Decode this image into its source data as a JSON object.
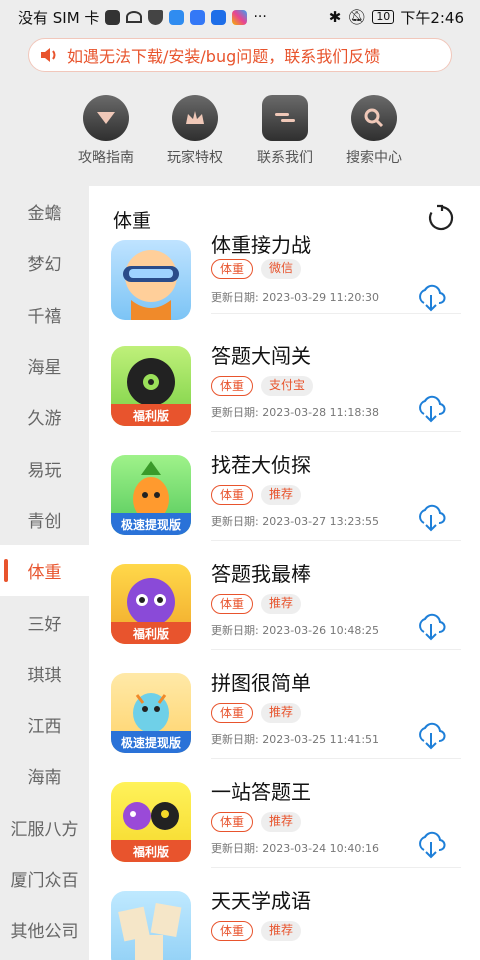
{
  "status_bar": {
    "carrier": "没有 SIM 卡",
    "battery": "10",
    "time": "下午2:46"
  },
  "notice": {
    "text": "如遇无法下载/安装/bug问题，联系我们反馈",
    "icon": "speaker-icon"
  },
  "quick_links": [
    {
      "label": "攻略指南",
      "icon": "diamond-icon"
    },
    {
      "label": "玩家特权",
      "icon": "crown-icon"
    },
    {
      "label": "联系我们",
      "icon": "chat-icon"
    },
    {
      "label": "搜索中心",
      "icon": "search-icon"
    }
  ],
  "sidebar": {
    "items": [
      "金蟾",
      "梦幻",
      "千禧",
      "海星",
      "久游",
      "易玩",
      "青创",
      "体重",
      "三好",
      "琪琪",
      "江西",
      "海南",
      "汇服八方",
      "厦门众百",
      "其他公司"
    ],
    "active": "体重"
  },
  "content": {
    "title": "体重",
    "date_prefix": "更新日期: ",
    "games": [
      {
        "name": "体重接力战",
        "tags": [
          "体重",
          "微信"
        ],
        "date": "2023-03-29 11:20:30",
        "band": ""
      },
      {
        "name": "答题大闯关",
        "tags": [
          "体重",
          "支付宝"
        ],
        "date": "2023-03-28 11:18:38",
        "band": "福利版"
      },
      {
        "name": "找茬大侦探",
        "tags": [
          "体重",
          "推荐"
        ],
        "date": "2023-03-27 13:23:55",
        "band": "极速提现版"
      },
      {
        "name": "答题我最棒",
        "tags": [
          "体重",
          "推荐"
        ],
        "date": "2023-03-26 10:48:25",
        "band": "福利版"
      },
      {
        "name": "拼图很简单",
        "tags": [
          "体重",
          "推荐"
        ],
        "date": "2023-03-25 11:41:51",
        "band": "极速提现版"
      },
      {
        "name": "一站答题王",
        "tags": [
          "体重",
          "推荐"
        ],
        "date": "2023-03-24 10:40:16",
        "band": "福利版"
      },
      {
        "name": "天天学成语",
        "tags": [
          "体重",
          "推荐"
        ],
        "date": "",
        "band": ""
      }
    ]
  },
  "colors": {
    "accent": "#e8542d",
    "band_red": "#e8542d",
    "band_blue": "#2a72d8"
  }
}
